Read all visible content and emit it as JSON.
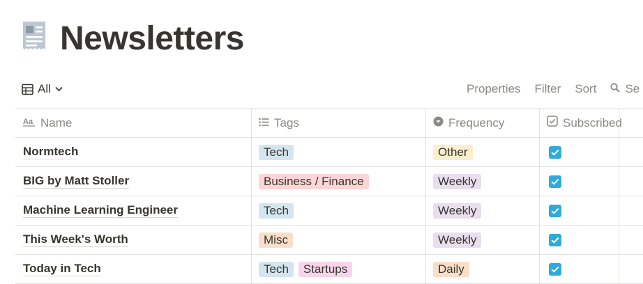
{
  "page": {
    "title": "Newsletters",
    "icon": "newspaper-icon"
  },
  "view": {
    "label": "All",
    "icon": "table-icon"
  },
  "toolbar": {
    "properties": "Properties",
    "filter": "Filter",
    "sort": "Sort",
    "search": "Se"
  },
  "columns": {
    "name": "Name",
    "tags": "Tags",
    "frequency": "Frequency",
    "subscribed": "Subscribed"
  },
  "tag_colors": {
    "Tech": "#d3e5ef",
    "Business / Finance": "#ffd5d7",
    "Misc": "#fadec9",
    "Startups": "#f5d6ea",
    "Other": "#fbeecc",
    "Weekly": "#e8deee",
    "Daily": "#fadec9"
  },
  "checkbox_color": "#2eaadc",
  "rows": [
    {
      "name": "Normtech",
      "tags": [
        "Tech"
      ],
      "frequency": "Other",
      "subscribed": true
    },
    {
      "name": "BIG by Matt Stoller",
      "tags": [
        "Business / Finance"
      ],
      "frequency": "Weekly",
      "subscribed": true
    },
    {
      "name": "Machine Learning Engineer",
      "tags": [
        "Tech"
      ],
      "frequency": "Weekly",
      "subscribed": true
    },
    {
      "name": "This Week's Worth",
      "tags": [
        "Misc"
      ],
      "frequency": "Weekly",
      "subscribed": true
    },
    {
      "name": "Today in Tech",
      "tags": [
        "Tech",
        "Startups"
      ],
      "frequency": "Daily",
      "subscribed": true
    }
  ]
}
